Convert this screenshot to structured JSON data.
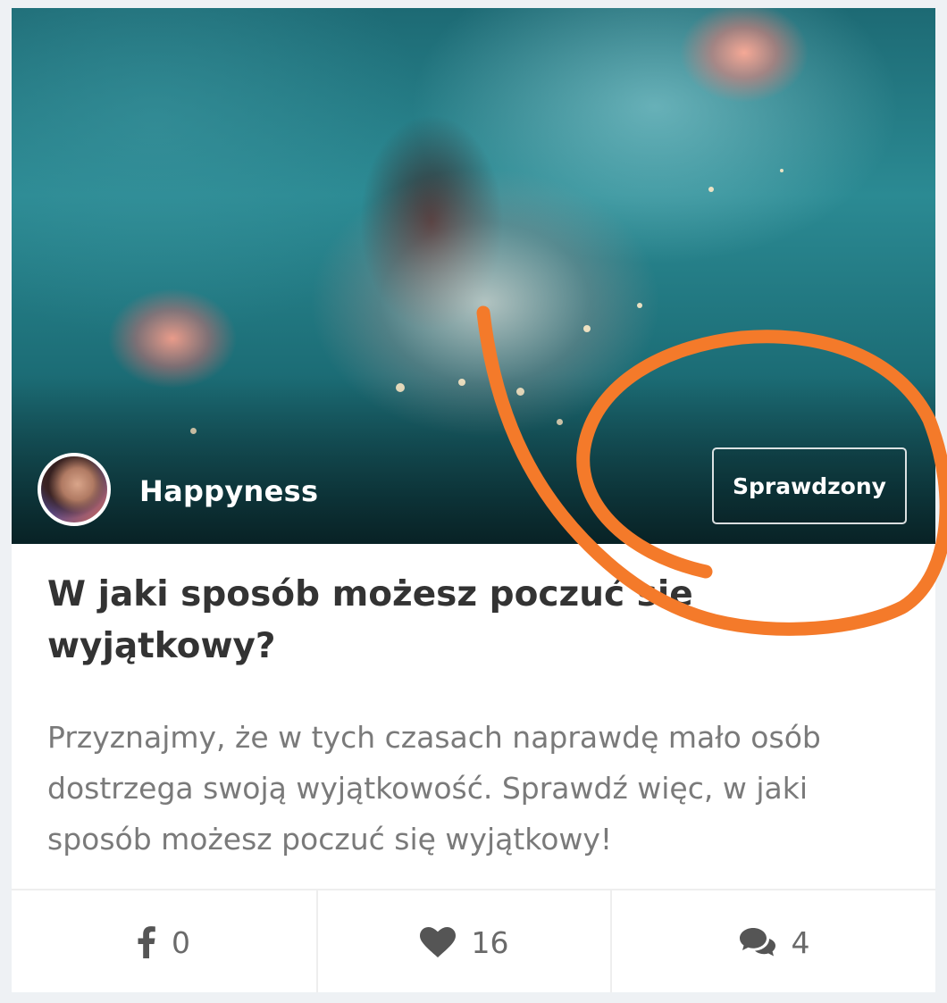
{
  "post": {
    "author": "Happyness",
    "badge": "Sprawdzony",
    "title": "W jaki sposób możesz poczuć się wyjątkowy?",
    "excerpt": "Przyznajmy, że w tych czasach naprawdę mało osób dostrzega swoją wyjątkowość. Sprawdź więc, w jaki sposób możesz poczuć się wyjątkowy!"
  },
  "stats": {
    "facebook_shares": "0",
    "likes": "16",
    "comments": "4"
  },
  "icons": [
    "facebook-icon",
    "heart-icon",
    "comments-icon"
  ],
  "colors": {
    "annotation_stroke": "#f47a2a",
    "title": "#333333",
    "excerpt": "#7a7a7a",
    "icon": "#555555"
  }
}
